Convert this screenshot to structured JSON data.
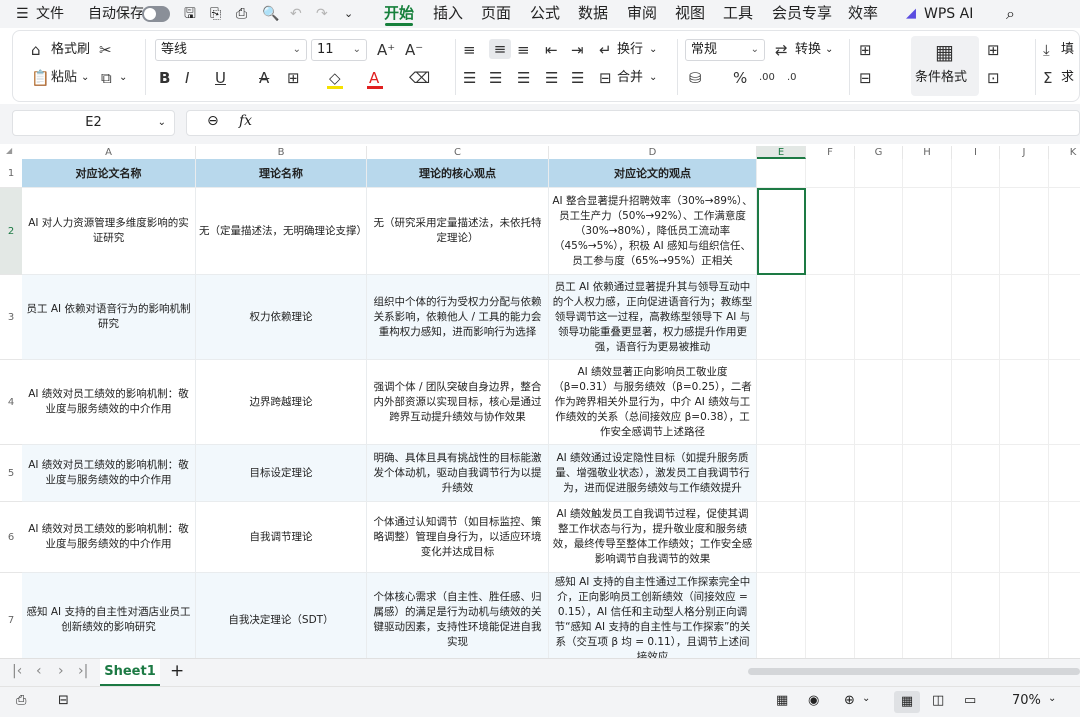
{
  "menubar": {
    "menu_label": "文件",
    "autosave_label": "自动保存",
    "tabs": [
      "开始",
      "插入",
      "页面",
      "公式",
      "数据",
      "审阅",
      "视图",
      "工具",
      "会员专享",
      "效率"
    ],
    "active_tab": "开始",
    "wps_ai": "WPS AI"
  },
  "ribbon": {
    "format_painter": "格式刷",
    "paste": "粘贴",
    "font_name": "等线",
    "font_size": "11",
    "wrap": "换行",
    "merge": "合并",
    "number_format": "常规",
    "convert": "转换",
    "conditional_format": "条件格式",
    "fill": "填",
    "sum": "求",
    "font_color": "#e02020",
    "highlight_color": "#f5e100"
  },
  "formula": {
    "name_box": "E2",
    "fx": "fx",
    "content": ""
  },
  "columns": [
    "A",
    "B",
    "C",
    "D",
    "E",
    "F",
    "G",
    "H",
    "I",
    "J",
    "K"
  ],
  "selected_cell": {
    "col": "E",
    "row": "2"
  },
  "table": {
    "headers": [
      "对应论文名称",
      "理论名称",
      "理论的核心观点",
      "对应论文的观点"
    ],
    "rows": [
      {
        "num": "2",
        "a": "AI 对人力资源管理多维度影响的实证研究",
        "b": "无（定量描述法，无明确理论支撑）",
        "c": "无（研究采用定量描述法，未依托特定理论）",
        "d": "AI 整合显著提升招聘效率（30%→89%）、员工生产力（50%→92%）、工作满意度（30%→80%），降低员工流动率（45%→5%），积极 AI 感知与组织信任、员工参与度（65%→95%）正相关"
      },
      {
        "num": "3",
        "a": "员工 AI 依赖对语音行为的影响机制研究",
        "b": "权力依赖理论",
        "c": "组织中个体的行为受权力分配与依赖关系影响，依赖他人 / 工具的能力会重构权力感知，进而影响行为选择",
        "d": "员工 AI 依赖通过显著提升其与领导互动中的个人权力感，正向促进语音行为；教练型领导调节这一过程，高教练型领导下 AI 与领导功能重叠更显著，权力感提升作用更强，语音行为更易被推动"
      },
      {
        "num": "4",
        "a": "AI 绩效对员工绩效的影响机制：敬业度与服务绩效的中介作用",
        "b": "边界跨越理论",
        "c": "强调个体 / 团队突破自身边界，整合内外部资源以实现目标，核心是通过跨界互动提升绩效与协作效果",
        "d": "AI 绩效显著正向影响员工敬业度（β=0.31）与服务绩效（β=0.25），二者作为跨界相关外显行为，中介 AI 绩效与工作绩效的关系（总间接效应 β=0.38），工作安全感调节上述路径"
      },
      {
        "num": "5",
        "a": "AI 绩效对员工绩效的影响机制：敬业度与服务绩效的中介作用",
        "b": "目标设定理论",
        "c": "明确、具体且具有挑战性的目标能激发个体动机，驱动自我调节行为以提升绩效",
        "d": "AI 绩效通过设定隐性目标（如提升服务质量、增强敬业状态），激发员工自我调节行为，进而促进服务绩效与工作绩效提升"
      },
      {
        "num": "6",
        "a": "AI 绩效对员工绩效的影响机制：敬业度与服务绩效的中介作用",
        "b": "自我调节理论",
        "c": "个体通过认知调节（如目标监控、策略调整）管理自身行为，以适应环境变化并达成目标",
        "d": "AI 绩效触发员工自我调节过程，促使其调整工作状态与行为，提升敬业度和服务绩效，最终传导至整体工作绩效；工作安全感影响调节自我调节的效果"
      },
      {
        "num": "7",
        "a": "感知 AI 支持的自主性对酒店业员工创新绩效的影响研究",
        "b": "自我决定理论（SDT）",
        "c": "个体核心需求（自主性、胜任感、归属感）的满足是行为动机与绩效的关键驱动因素，支持性环境能促进自我实现",
        "d": "感知 AI 支持的自主性通过工作探索完全中介，正向影响员工创新绩效（间接效应 = 0.15），AI 信任和主动型人格分别正向调节“感知 AI 支持的自主性与工作探索”的关系（交互项 β 均 = 0.11），且调节上述间接效应"
      }
    ]
  },
  "sheet": {
    "name": "Sheet1",
    "add": "+"
  },
  "status": {
    "zoom": "70%"
  }
}
